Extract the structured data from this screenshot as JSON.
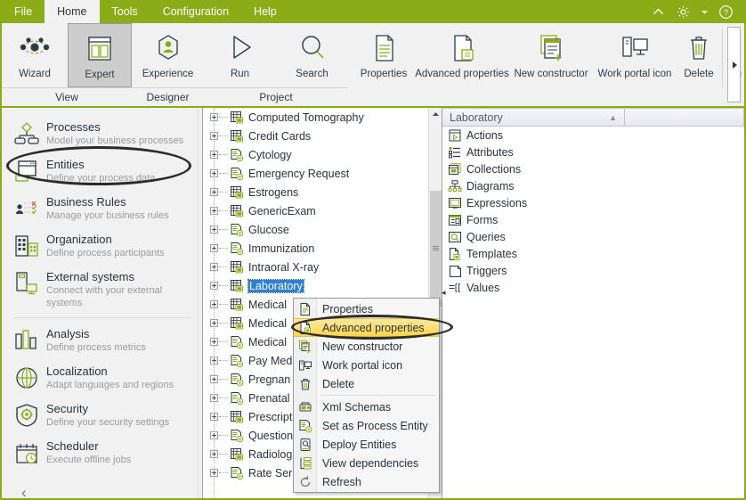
{
  "window": {
    "accent_green": "#8aad17",
    "ribbon_bg": "#f1f1f1"
  },
  "menubar": {
    "items": [
      {
        "label": "File",
        "active": false
      },
      {
        "label": "Home",
        "active": true
      },
      {
        "label": "Tools",
        "active": false
      },
      {
        "label": "Configuration",
        "active": false
      },
      {
        "label": "Help",
        "active": false
      }
    ],
    "system_icons": [
      {
        "name": "collapse-ribbon-icon",
        "glyph": "chevron-up"
      },
      {
        "name": "settings-gear-icon",
        "glyph": "gear"
      },
      {
        "name": "settings-dropdown-icon",
        "glyph": "caret-down"
      },
      {
        "name": "help-icon",
        "glyph": "question-circle"
      }
    ]
  },
  "ribbon": {
    "groups": [
      {
        "label": "View",
        "buttons": [
          {
            "label": "Wizard",
            "icon": "wizard-nodes-icon",
            "selected": false
          },
          {
            "label": "Expert",
            "icon": "expert-layout-icon",
            "selected": true
          }
        ]
      },
      {
        "label": "Designer",
        "buttons": [
          {
            "label": "Experience",
            "icon": "experience-person-icon",
            "selected": false
          }
        ]
      },
      {
        "label": "Project",
        "buttons": [
          {
            "label": "Run",
            "icon": "run-play-icon",
            "selected": false
          },
          {
            "label": "Search",
            "icon": "search-magnifier-icon",
            "selected": false
          }
        ]
      },
      {
        "label": "",
        "buttons": [
          {
            "label": "Properties",
            "icon": "properties-document-icon",
            "selected": false
          },
          {
            "label": "Advanced properties",
            "icon": "advanced-properties-document-icon",
            "selected": false
          },
          {
            "label": "New constructor",
            "icon": "new-constructor-icon",
            "selected": false
          },
          {
            "label": "Work portal icon",
            "icon": "work-portal-icon",
            "selected": false
          },
          {
            "label": "Delete",
            "icon": "delete-trash-icon",
            "selected": false
          },
          {
            "label": "Sh",
            "icon": "share-icon",
            "selected": false
          }
        ]
      }
    ]
  },
  "sidebar": {
    "items": [
      {
        "title": "Processes",
        "subtitle": "Model your business processes",
        "icon": "processes-icon",
        "highlighted": false
      },
      {
        "title": "Entities",
        "subtitle": "Define your process data",
        "icon": "entities-icon",
        "highlighted": true
      },
      {
        "title": "Business Rules",
        "subtitle": "Manage your business rules",
        "icon": "business-rules-icon",
        "highlighted": false
      },
      {
        "title": "Organization",
        "subtitle": "Define process participants",
        "icon": "organization-icon",
        "highlighted": false
      },
      {
        "title": "External systems",
        "subtitle": "Connect with your external systems",
        "icon": "external-systems-icon",
        "highlighted": false
      },
      {
        "title": "Analysis",
        "subtitle": "Define process metrics",
        "icon": "analysis-icon",
        "highlighted": false
      },
      {
        "title": "Localization",
        "subtitle": "Adapt languages and regions",
        "icon": "localization-icon",
        "highlighted": false
      },
      {
        "title": "Security",
        "subtitle": "Define your security settings",
        "icon": "security-icon",
        "highlighted": false
      },
      {
        "title": "Scheduler",
        "subtitle": "Execute offline jobs",
        "icon": "scheduler-icon",
        "highlighted": false
      }
    ],
    "collapse_label": "‹"
  },
  "tree": {
    "items": [
      {
        "label": "Computed Tomography",
        "icon": "entity-grid-icon",
        "selected": false
      },
      {
        "label": "Credit Cards",
        "icon": "entity-grid-icon",
        "selected": false
      },
      {
        "label": "Cytology",
        "icon": "entity-doc-icon",
        "selected": false
      },
      {
        "label": "Emergency Request",
        "icon": "entity-doc-icon",
        "selected": false
      },
      {
        "label": "Estrogens",
        "icon": "entity-grid-icon",
        "selected": false
      },
      {
        "label": "GenericExam",
        "icon": "entity-grid-icon",
        "selected": false
      },
      {
        "label": "Glucose",
        "icon": "entity-doc-icon",
        "selected": false
      },
      {
        "label": "Immunization",
        "icon": "entity-doc-icon",
        "selected": false
      },
      {
        "label": "Intraoral X-ray",
        "icon": "entity-grid-icon",
        "selected": false
      },
      {
        "label": "Laboratory",
        "icon": "entity-grid-icon",
        "selected": true
      },
      {
        "label": "Medical",
        "icon": "entity-grid-icon",
        "selected": false
      },
      {
        "label": "Medical",
        "icon": "entity-grid-icon",
        "selected": false
      },
      {
        "label": "Medical",
        "icon": "entity-doc-icon",
        "selected": false
      },
      {
        "label": "Pay Med",
        "icon": "entity-doc-icon",
        "selected": false
      },
      {
        "label": "Pregnan",
        "icon": "entity-doc-icon",
        "selected": false
      },
      {
        "label": "Prenatal",
        "icon": "entity-doc-icon",
        "selected": false
      },
      {
        "label": "Prescript",
        "icon": "entity-grid-icon",
        "selected": false
      },
      {
        "label": "Question",
        "icon": "entity-doc-icon",
        "selected": false
      },
      {
        "label": "Radiolog",
        "icon": "entity-grid-icon",
        "selected": false
      },
      {
        "label": "Rate Ser",
        "icon": "entity-doc-icon",
        "selected": false
      }
    ]
  },
  "context_menu": {
    "items": [
      {
        "label": "Properties",
        "icon": "properties-document-icon",
        "highlighted": false,
        "separator_after": false
      },
      {
        "label": "Advanced properties",
        "icon": "advanced-properties-document-icon",
        "highlighted": true,
        "separator_after": false
      },
      {
        "label": "New constructor",
        "icon": "new-constructor-icon",
        "highlighted": false,
        "separator_after": false
      },
      {
        "label": "Work portal icon",
        "icon": "work-portal-icon",
        "highlighted": false,
        "separator_after": false
      },
      {
        "label": "Delete",
        "icon": "delete-trash-icon",
        "highlighted": false,
        "separator_after": true
      },
      {
        "label": "Xml Schemas",
        "icon": "xml-schemas-icon",
        "highlighted": false,
        "separator_after": false
      },
      {
        "label": "Set as Process Entity",
        "icon": "set-process-entity-icon",
        "highlighted": false,
        "separator_after": false
      },
      {
        "label": "Deploy Entities",
        "icon": "deploy-entities-icon",
        "highlighted": false,
        "separator_after": false
      },
      {
        "label": "View dependencies",
        "icon": "view-dependencies-icon",
        "highlighted": false,
        "separator_after": false
      },
      {
        "label": "Refresh",
        "icon": "refresh-icon",
        "highlighted": false,
        "separator_after": false
      }
    ]
  },
  "details_panel": {
    "header_title": "Laboratory",
    "header_sort_glyph": "▲",
    "items": [
      {
        "label": "Actions",
        "icon": "actions-icon"
      },
      {
        "label": "Attributes",
        "icon": "attributes-icon"
      },
      {
        "label": "Collections",
        "icon": "collections-icon"
      },
      {
        "label": "Diagrams",
        "icon": "diagrams-icon"
      },
      {
        "label": "Expressions",
        "icon": "expressions-icon"
      },
      {
        "label": "Forms",
        "icon": "forms-icon"
      },
      {
        "label": "Queries",
        "icon": "queries-icon"
      },
      {
        "label": "Templates",
        "icon": "templates-icon"
      },
      {
        "label": "Triggers",
        "icon": "triggers-icon"
      },
      {
        "label": "Values",
        "icon": "values-icon"
      }
    ]
  }
}
